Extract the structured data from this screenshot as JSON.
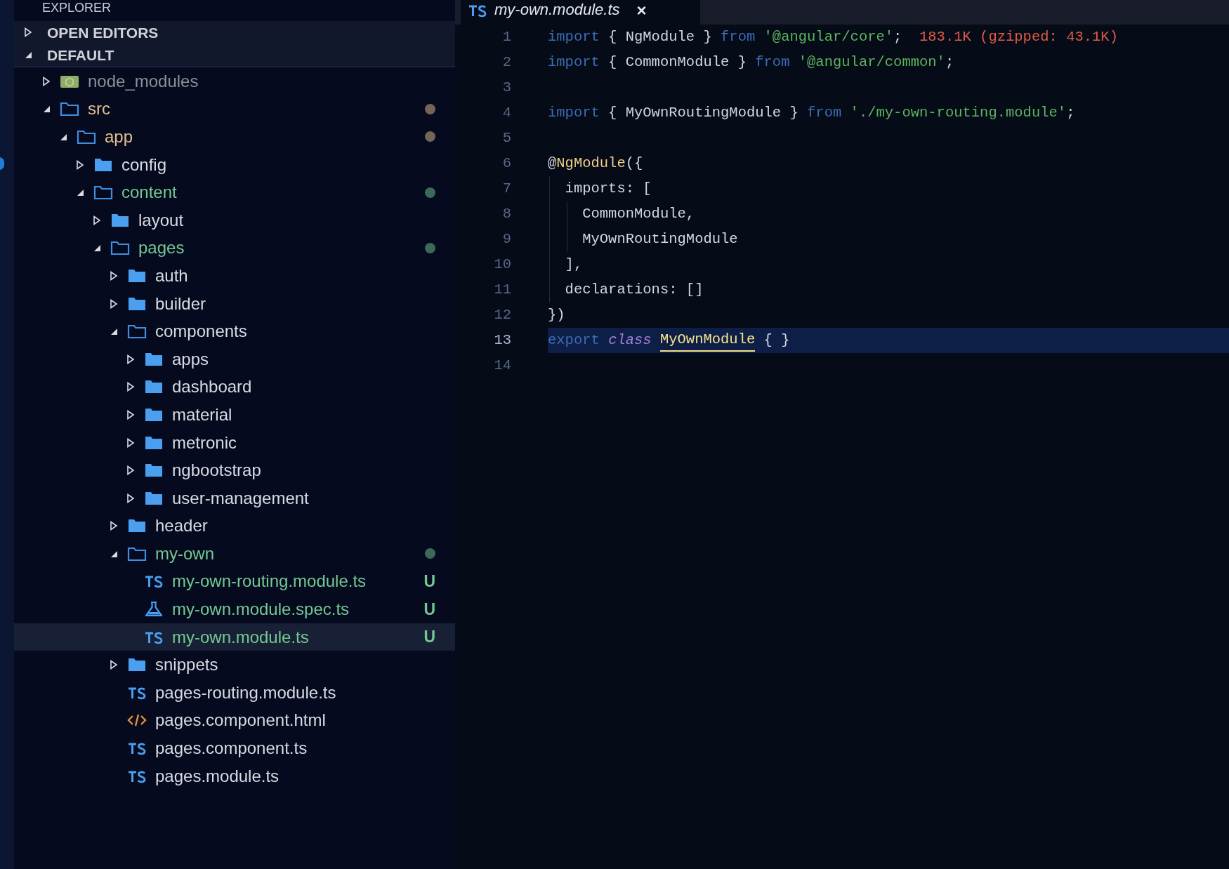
{
  "sidebar": {
    "title": "EXPLORER",
    "sections": [
      {
        "label": "OPEN EDITORS",
        "expanded": false
      },
      {
        "label": "DEFAULT",
        "expanded": true
      }
    ],
    "tree": [
      {
        "kind": "package-folder",
        "name": "node_modules",
        "expanded": false,
        "color": "#8c8f99",
        "selected": false
      },
      {
        "kind": "folder",
        "name": "src",
        "expanded": true,
        "color": "#e2c08d",
        "dot": true,
        "selected": false,
        "children": [
          {
            "kind": "folder",
            "name": "app",
            "expanded": true,
            "color": "#e2c08d",
            "dot": true,
            "selected": false,
            "children": [
              {
                "kind": "folder",
                "name": "config",
                "expanded": false,
                "selected": false
              },
              {
                "kind": "folder",
                "name": "content",
                "expanded": true,
                "color": "#73c991",
                "dot": true,
                "selected": false,
                "children": [
                  {
                    "kind": "folder",
                    "name": "layout",
                    "expanded": false,
                    "selected": false
                  },
                  {
                    "kind": "folder",
                    "name": "pages",
                    "expanded": true,
                    "color": "#73c991",
                    "dot": true,
                    "selected": false,
                    "children": [
                      {
                        "kind": "folder",
                        "name": "auth",
                        "expanded": false,
                        "selected": false
                      },
                      {
                        "kind": "folder",
                        "name": "builder",
                        "expanded": false,
                        "selected": false
                      },
                      {
                        "kind": "folder",
                        "name": "components",
                        "expanded": true,
                        "selected": false,
                        "children": [
                          {
                            "kind": "folder",
                            "name": "apps",
                            "expanded": false,
                            "selected": false
                          },
                          {
                            "kind": "folder",
                            "name": "dashboard",
                            "expanded": false,
                            "selected": false
                          },
                          {
                            "kind": "folder",
                            "name": "material",
                            "expanded": false,
                            "selected": false
                          },
                          {
                            "kind": "folder",
                            "name": "metronic",
                            "expanded": false,
                            "selected": false
                          },
                          {
                            "kind": "folder",
                            "name": "ngbootstrap",
                            "expanded": false,
                            "selected": false
                          },
                          {
                            "kind": "folder",
                            "name": "user-management",
                            "expanded": false,
                            "selected": false
                          }
                        ]
                      },
                      {
                        "kind": "folder",
                        "name": "header",
                        "expanded": false,
                        "selected": false
                      },
                      {
                        "kind": "folder",
                        "name": "my-own",
                        "expanded": true,
                        "color": "#73c991",
                        "dot": true,
                        "selected": false,
                        "children": [
                          {
                            "kind": "ts-file",
                            "name": "my-own-routing.module.ts",
                            "color": "#73c991",
                            "badge": "U",
                            "selected": false
                          },
                          {
                            "kind": "test-file",
                            "name": "my-own.module.spec.ts",
                            "color": "#73c991",
                            "badge": "U",
                            "selected": false
                          },
                          {
                            "kind": "ts-file",
                            "name": "my-own.module.ts",
                            "color": "#73c991",
                            "badge": "U",
                            "selected": true
                          }
                        ]
                      },
                      {
                        "kind": "folder",
                        "name": "snippets",
                        "expanded": false,
                        "selected": false
                      },
                      {
                        "kind": "ts-file",
                        "name": "pages-routing.module.ts",
                        "selected": false
                      },
                      {
                        "kind": "html-file",
                        "name": "pages.component.html",
                        "selected": false
                      },
                      {
                        "kind": "ts-file",
                        "name": "pages.component.ts",
                        "selected": false
                      },
                      {
                        "kind": "ts-file",
                        "name": "pages.module.ts",
                        "selected": false
                      }
                    ]
                  }
                ]
              }
            ]
          }
        ]
      }
    ]
  },
  "editor": {
    "tab": {
      "kind": "ts-file",
      "label": "my-own.module.ts",
      "close": "×"
    },
    "lines": [
      {
        "number": "1",
        "current": false,
        "tokens": [
          {
            "kind": "keyword",
            "text": "import"
          },
          {
            "kind": "plain",
            "text": " { NgModule } "
          },
          {
            "kind": "keyword",
            "text": "from "
          },
          {
            "kind": "string",
            "text": "'@angular/core'"
          },
          {
            "kind": "plain",
            "text": ";  "
          },
          {
            "kind": "annotation",
            "text": "183.1K (gzipped: 43.1K)"
          }
        ]
      },
      {
        "number": "2",
        "current": false,
        "tokens": [
          {
            "kind": "keyword",
            "text": "import"
          },
          {
            "kind": "plain",
            "text": " { CommonModule } "
          },
          {
            "kind": "keyword",
            "text": "from "
          },
          {
            "kind": "string",
            "text": "'@angular/common'"
          },
          {
            "kind": "plain",
            "text": ";"
          }
        ]
      },
      {
        "number": "3",
        "current": false
      },
      {
        "number": "4",
        "current": false,
        "tokens": [
          {
            "kind": "keyword",
            "text": "import"
          },
          {
            "kind": "plain",
            "text": " { MyOwnRoutingModule } "
          },
          {
            "kind": "keyword",
            "text": "from "
          },
          {
            "kind": "string",
            "text": "'./my-own-routing.module'"
          },
          {
            "kind": "plain",
            "text": ";"
          }
        ]
      },
      {
        "number": "5",
        "current": false
      },
      {
        "number": "6",
        "current": false,
        "tokens": [
          {
            "kind": "plain",
            "text": "@"
          },
          {
            "kind": "decorator",
            "text": "NgModule"
          },
          {
            "kind": "plain",
            "text": "({"
          }
        ]
      },
      {
        "number": "7",
        "current": false,
        "tokens": [
          {
            "kind": "plain",
            "text": "  imports: ["
          }
        ]
      },
      {
        "number": "8",
        "current": false,
        "tokens": [
          {
            "kind": "plain",
            "text": "    CommonModule,"
          }
        ]
      },
      {
        "number": "9",
        "current": false,
        "tokens": [
          {
            "kind": "plain",
            "text": "    MyOwnRoutingModule"
          }
        ]
      },
      {
        "number": "10",
        "current": false,
        "tokens": [
          {
            "kind": "plain",
            "text": "  ],"
          }
        ]
      },
      {
        "number": "11",
        "current": false,
        "tokens": [
          {
            "kind": "plain",
            "text": "  declarations: []"
          }
        ]
      },
      {
        "number": "12",
        "current": false,
        "tokens": [
          {
            "kind": "plain",
            "text": "})"
          }
        ]
      },
      {
        "number": "13",
        "current": true,
        "tokens": [
          {
            "kind": "keyword",
            "text": "export "
          },
          {
            "kind": "storage",
            "text": "class "
          },
          {
            "kind": "class-highlight",
            "text": "MyOwnModule"
          },
          {
            "kind": "plain",
            "text": " { }"
          }
        ]
      },
      {
        "number": "14",
        "current": false
      }
    ]
  }
}
